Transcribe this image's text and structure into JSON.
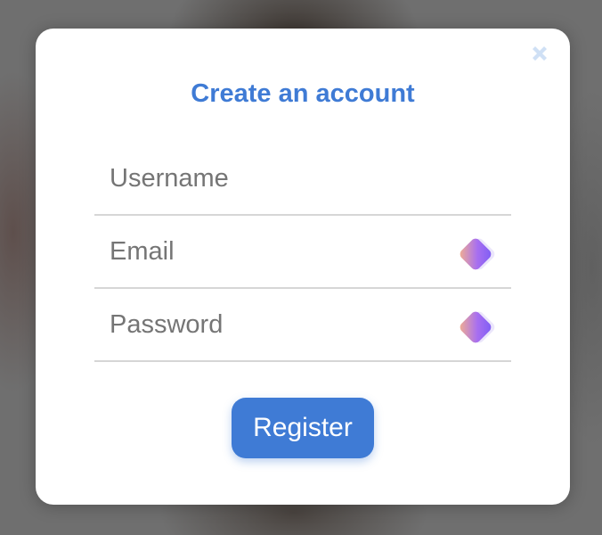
{
  "dialog": {
    "title": "Create an account",
    "close_icon": "close-icon"
  },
  "form": {
    "username": {
      "placeholder": "Username",
      "value": ""
    },
    "email": {
      "placeholder": "Email",
      "value": "",
      "icon": "password-manager-icon"
    },
    "password": {
      "placeholder": "Password",
      "value": "",
      "icon": "password-manager-icon"
    },
    "submit_label": "Register"
  },
  "colors": {
    "accent": "#3f7bd5",
    "close_icon": "#cfe0f5",
    "divider": "#d6d6d6",
    "placeholder": "#757575"
  }
}
